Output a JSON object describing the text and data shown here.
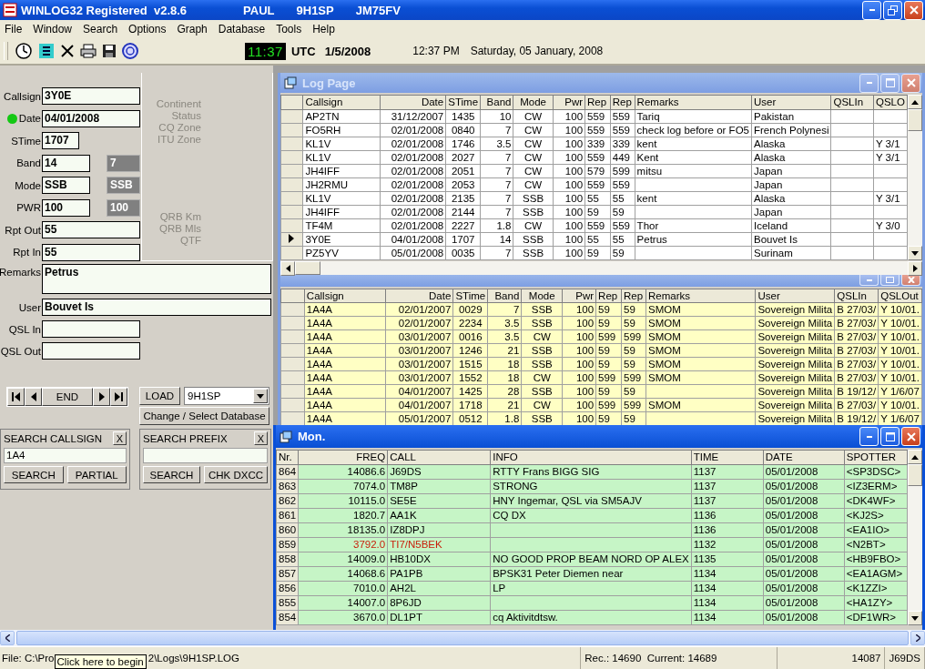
{
  "window": {
    "title": "WINLOG32 Registered  v2.8.6",
    "operator": "PAUL",
    "callsign": "9H1SP",
    "locator": "JM75FV"
  },
  "menu": [
    "File",
    "Window",
    "Search",
    "Options",
    "Graph",
    "Database",
    "Tools",
    "Help"
  ],
  "toolbar": {
    "clock": "11:37",
    "clock_zone": "UTC",
    "utc_date": "1/5/2008",
    "local_time": "12:37 PM",
    "local_date": "Saturday, 05 January, 2008"
  },
  "qso_form": {
    "fields": [
      {
        "label": "Callsign",
        "value": "3Y0E",
        "kind": "short"
      },
      {
        "label": "Date",
        "value": "04/01/2008",
        "kind": "short",
        "color": "#14c814"
      },
      {
        "label": "STime",
        "value": "1707",
        "kind": "tiny"
      },
      {
        "label": "Band",
        "value": "14",
        "kind": "paired",
        "echo": "7"
      },
      {
        "label": "Mode",
        "value": "SSB",
        "kind": "paired",
        "echo": "SSB"
      },
      {
        "label": "PWR",
        "value": "100",
        "kind": "paired",
        "echo": "100"
      },
      {
        "label": "Rpt Out",
        "value": "55",
        "kind": "short"
      },
      {
        "label": "Rpt In",
        "value": "55",
        "kind": "short"
      }
    ],
    "info_labels": [
      "Continent",
      "Status",
      "CQ Zone",
      "ITU Zone"
    ],
    "distance_labels": [
      "QRB Km",
      "QRB Mls",
      "QTF"
    ],
    "more_fields": [
      {
        "label": "Remarks",
        "value": "Petrus",
        "kind": "tall"
      },
      {
        "label": "User",
        "value": "Bouvet Is",
        "kind": "wide"
      },
      {
        "label": "QSL In",
        "kind": "short"
      },
      {
        "label": "QSL Out",
        "kind": "short"
      }
    ]
  },
  "navigator": {
    "end": "END",
    "load": "LOAD",
    "database": "9H1SP",
    "change_database": "Change / Select Database"
  },
  "search_panels": [
    {
      "title": "SEARCH CALLSIGN",
      "close": "X",
      "value": "1A4",
      "buttons": [
        "SEARCH",
        "PARTIAL"
      ]
    },
    {
      "title": "SEARCH PREFIX",
      "close": "X",
      "buttons": [
        "SEARCH",
        "CHK DXCC"
      ]
    }
  ],
  "log_page": {
    "title": "Log Page",
    "columns": [
      "Callsign",
      "Date",
      "STime",
      "Band",
      "Mode",
      "Pwr",
      "Rep",
      "Rep",
      "Remarks",
      "User",
      "QSLIn",
      "QSLO"
    ],
    "rows": [
      {
        "selected": false,
        "cells": [
          "AP2TN",
          "31/12/2007",
          "1435",
          "10",
          "CW",
          "100",
          "559",
          "559",
          "Tariq",
          "Pakistan",
          null,
          null
        ]
      },
      {
        "selected": false,
        "cells": [
          "FO5RH",
          "02/01/2008",
          "0840",
          "7",
          "CW",
          "100",
          "559",
          "559",
          "check log before  or FO5",
          "French Polynesi",
          null,
          null
        ]
      },
      {
        "selected": false,
        "cells": [
          "KL1V",
          "02/01/2008",
          "1746",
          "3.5",
          "CW",
          "100",
          "339",
          "339",
          "kent",
          "Alaska",
          null,
          "Y 3/1"
        ]
      },
      {
        "selected": false,
        "cells": [
          "KL1V",
          "02/01/2008",
          "2027",
          "7",
          "CW",
          "100",
          "559",
          "449",
          "Kent",
          "Alaska",
          null,
          "Y 3/1"
        ]
      },
      {
        "selected": false,
        "cells": [
          "JH4IFF",
          "02/01/2008",
          "2051",
          "7",
          "CW",
          "100",
          "579",
          "599",
          "mitsu",
          "Japan",
          null,
          null
        ]
      },
      {
        "selected": false,
        "cells": [
          "JH2RMU",
          "02/01/2008",
          "2053",
          "7",
          "CW",
          "100",
          "559",
          "559",
          null,
          "Japan",
          null,
          null
        ]
      },
      {
        "selected": false,
        "cells": [
          "KL1V",
          "02/01/2008",
          "2135",
          "7",
          "SSB",
          "100",
          "55",
          "55",
          "kent",
          "Alaska",
          null,
          "Y 3/1"
        ]
      },
      {
        "selected": false,
        "cells": [
          "JH4IFF",
          "02/01/2008",
          "2144",
          "7",
          "SSB",
          "100",
          "59",
          "59",
          null,
          "Japan",
          null,
          null
        ]
      },
      {
        "selected": false,
        "cells": [
          "TF4M",
          "02/01/2008",
          "2227",
          "1.8",
          "CW",
          "100",
          "559",
          "559",
          "Thor",
          "Iceland",
          null,
          "Y 3/0"
        ]
      },
      {
        "selected": true,
        "cells": [
          "3Y0E",
          "04/01/2008",
          "1707",
          "14",
          "SSB",
          "100",
          "55",
          "55",
          "Petrus",
          "Bouvet Is",
          null,
          null
        ]
      },
      {
        "selected": false,
        "cells": [
          "PZ5YV",
          "05/01/2008",
          "0035",
          "7",
          "SSB",
          "100",
          "59",
          "59",
          null,
          "Surinam",
          null,
          null
        ]
      }
    ]
  },
  "search_results": {
    "columns": [
      "Callsign",
      "Date",
      "STime",
      "Band",
      "Mode",
      "Pwr",
      "Rep",
      "Rep",
      "Remarks",
      "User",
      "QSLIn",
      "QSLOut"
    ],
    "rows": [
      [
        "1A4A",
        "02/01/2007",
        "0029",
        "7",
        "SSB",
        "100",
        "59",
        "59",
        "SMOM",
        "Sovereign Milita",
        "B 27/03/",
        "Y 10/01."
      ],
      [
        "1A4A",
        "02/01/2007",
        "2234",
        "3.5",
        "SSB",
        "100",
        "59",
        "59",
        "SMOM",
        "Sovereign Milita",
        "B 27/03/",
        "Y 10/01."
      ],
      [
        "1A4A",
        "03/01/2007",
        "0016",
        "3.5",
        "CW",
        "100",
        "599",
        "599",
        "SMOM",
        "Sovereign Milita",
        "B 27/03/",
        "Y 10/01."
      ],
      [
        "1A4A",
        "03/01/2007",
        "1246",
        "21",
        "SSB",
        "100",
        "59",
        "59",
        "SMOM",
        "Sovereign Milita",
        "B 27/03/",
        "Y 10/01."
      ],
      [
        "1A4A",
        "03/01/2007",
        "1515",
        "18",
        "SSB",
        "100",
        "59",
        "59",
        "SMOM",
        "Sovereign Milita",
        "B 27/03/",
        "Y 10/01."
      ],
      [
        "1A4A",
        "03/01/2007",
        "1552",
        "18",
        "CW",
        "100",
        "599",
        "599",
        "SMOM",
        "Sovereign Milita",
        "B 27/03/",
        "Y 10/01."
      ],
      [
        "1A4A",
        "04/01/2007",
        "1425",
        "28",
        "SSB",
        "100",
        "59",
        "59",
        null,
        "Sovereign Milita",
        "B 19/12/",
        "Y 1/6/07"
      ],
      [
        "1A4A",
        "04/01/2007",
        "1718",
        "21",
        "CW",
        "100",
        "599",
        "599",
        "SMOM",
        "Sovereign Milita",
        "B 27/03/",
        "Y 10/01."
      ],
      [
        "1A4A",
        "05/01/2007",
        "0512",
        "1.8",
        "SSB",
        "100",
        "59",
        "59",
        null,
        "Sovereign Milita",
        "B 19/12/",
        "Y 1/6/07"
      ]
    ]
  },
  "monitor": {
    "title": "Mon.",
    "columns": [
      "Nr.",
      "FREQ",
      "CALL",
      "INFO",
      "TIME",
      "DATE",
      "SPOTTER"
    ],
    "rows": [
      {
        "nr": "864",
        "freq": "14086.6",
        "call": "J69DS",
        "info": "RTTY Frans BIGG SIG",
        "time": "1137",
        "date": "05/01/2008",
        "spotter": "<SP3DSC>"
      },
      {
        "nr": "863",
        "freq": "7074.0",
        "call": "TM8P",
        "info": "STRONG",
        "time": "1137",
        "date": "05/01/2008",
        "spotter": "<IZ3ERM>"
      },
      {
        "nr": "862",
        "freq": "10115.0",
        "call": "SE5E",
        "info": "HNY Ingemar, QSL via SM5AJV",
        "time": "1137",
        "date": "05/01/2008",
        "spotter": "<DK4WF>"
      },
      {
        "nr": "861",
        "freq": "1820.7",
        "call": "AA1K",
        "info": "CQ DX",
        "time": "1136",
        "date": "05/01/2008",
        "spotter": "<KJ2S>"
      },
      {
        "nr": "860",
        "freq": "18135.0",
        "call": "IZ8DPJ",
        "time": "1136",
        "date": "05/01/2008",
        "spotter": "<EA1IO>"
      },
      {
        "nr": "859",
        "freq": "3792.0",
        "call": "TI7/N5BEK",
        "time": "1132",
        "date": "05/01/2008",
        "spotter": "<N2BT>",
        "color": "#c81e0a"
      },
      {
        "nr": "858",
        "freq": "14009.0",
        "call": "HB10DX",
        "info": "NO GOOD PROP BEAM NORD OP ALEX",
        "time": "1135",
        "date": "05/01/2008",
        "spotter": "<HB9FBO>"
      },
      {
        "nr": "857",
        "freq": "14068.6",
        "call": "PA1PB",
        "info": "BPSK31 Peter Diemen near",
        "time": "1134",
        "date": "05/01/2008",
        "spotter": "<EA1AGM>"
      },
      {
        "nr": "856",
        "freq": "7010.0",
        "call": "AH2L",
        "info": "LP",
        "time": "1134",
        "date": "05/01/2008",
        "spotter": "<K1ZZI>"
      },
      {
        "nr": "855",
        "freq": "14007.0",
        "call": "8P6JD",
        "time": "1134",
        "date": "05/01/2008",
        "spotter": "<HA1ZY>"
      },
      {
        "nr": "854",
        "freq": "3670.0",
        "call": "DL1PT",
        "info": "cq Aktivitdtsw.",
        "time": "1134",
        "date": "05/01/2008",
        "spotter": "<DF1WR>"
      }
    ]
  },
  "status_bar": {
    "file_start": "File: C:\\Pro",
    "tooltip": "Click here to begin",
    "file_end": "2\\Logs\\9H1SP.LOG",
    "records": "Rec.: 14690  Current: 14689",
    "frequency": "14087",
    "call": "J69DS"
  }
}
